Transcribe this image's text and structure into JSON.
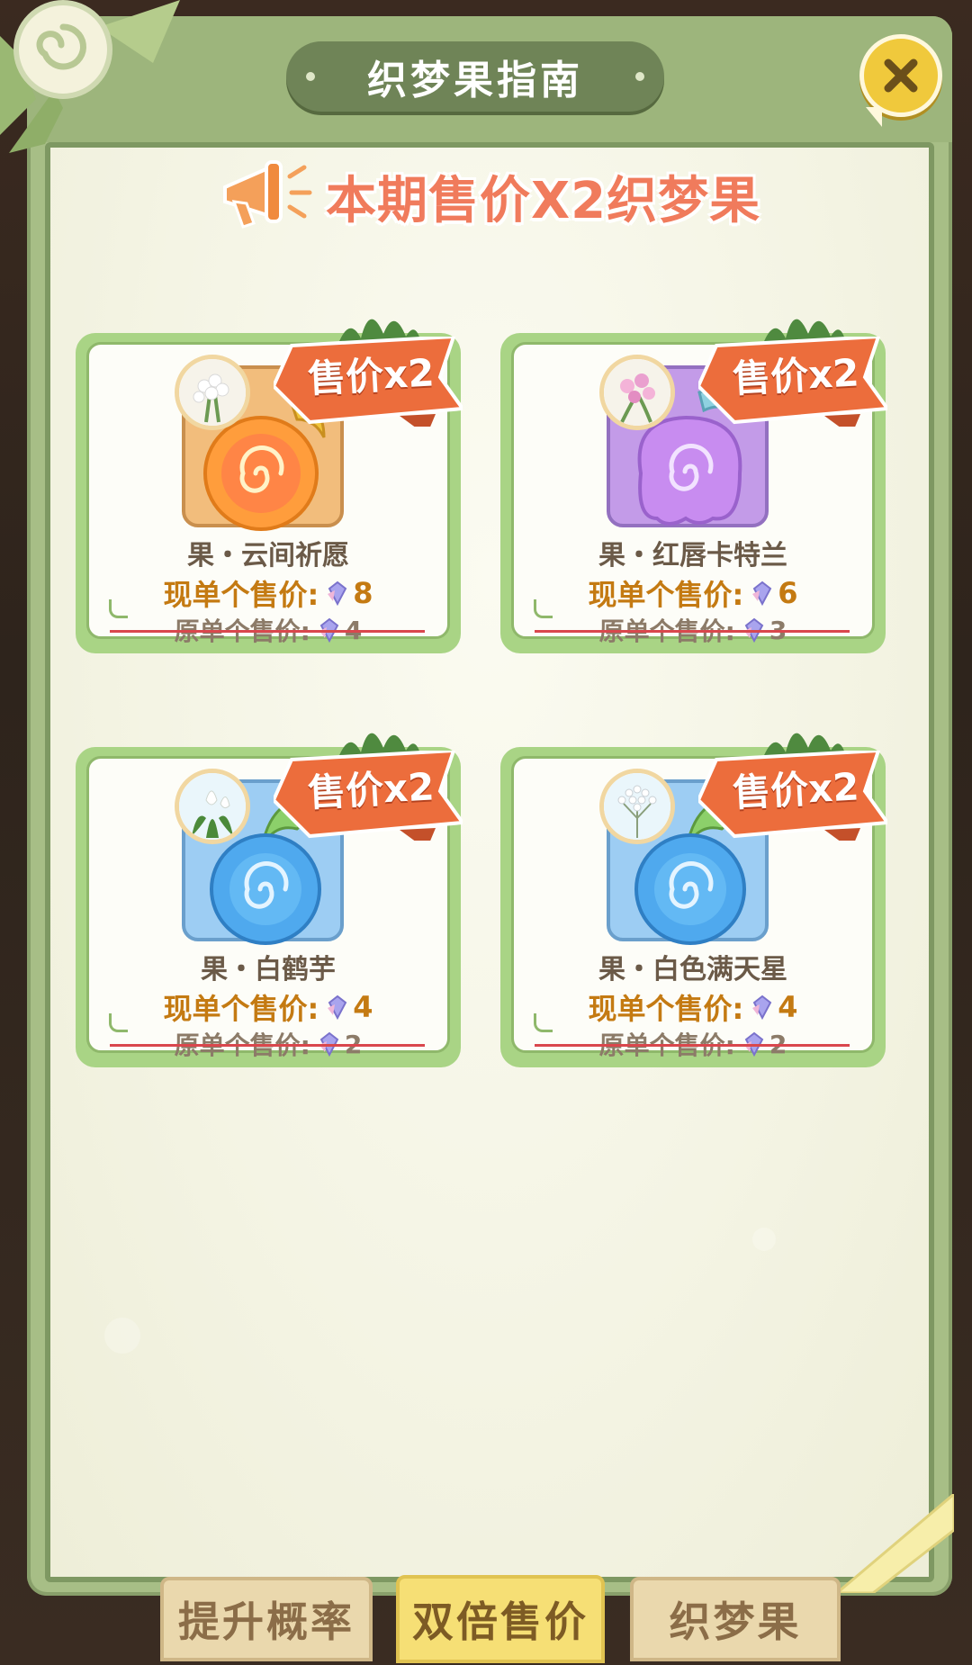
{
  "header": {
    "title": "织梦果指南"
  },
  "banner": {
    "text": "本期售价X2织梦果"
  },
  "cards": [
    {
      "tag": "售价x2",
      "name": "果・云间祈愿",
      "now_label": "现单个售价:",
      "now_value": "8",
      "old_label": "原单个售价:",
      "old_value": "4",
      "tile_color": "orange",
      "flower": "white-hyacinth"
    },
    {
      "tag": "售价x2",
      "name": "果・红唇卡特兰",
      "now_label": "现单个售价:",
      "now_value": "6",
      "old_label": "原单个售价:",
      "old_value": "3",
      "tile_color": "purple",
      "flower": "pink-cattleya"
    },
    {
      "tag": "售价x2",
      "name": "果・白鹤芋",
      "now_label": "现单个售价:",
      "now_value": "4",
      "old_label": "原单个售价:",
      "old_value": "2",
      "tile_color": "blue",
      "flower": "peace-lily"
    },
    {
      "tag": "售价x2",
      "name": "果・白色满天星",
      "now_label": "现单个售价:",
      "now_value": "4",
      "old_label": "原单个售价:",
      "old_value": "2",
      "tile_color": "blue",
      "flower": "white-babys-breath"
    }
  ],
  "tabs": [
    {
      "label": "提升概率",
      "active": false
    },
    {
      "label": "双倍售价",
      "active": true
    },
    {
      "label": "织梦果",
      "active": false
    }
  ],
  "icons": {
    "close": "close-icon",
    "currency": "gem-icon",
    "megaphone": "megaphone-icon"
  },
  "colors": {
    "panel_green": "#a7be86",
    "banner_text": "#f07b5c",
    "tag_orange": "#ec6d3c",
    "price_now": "#c47a12",
    "strike": "#d9474d",
    "active_tab": "#f6df75"
  }
}
